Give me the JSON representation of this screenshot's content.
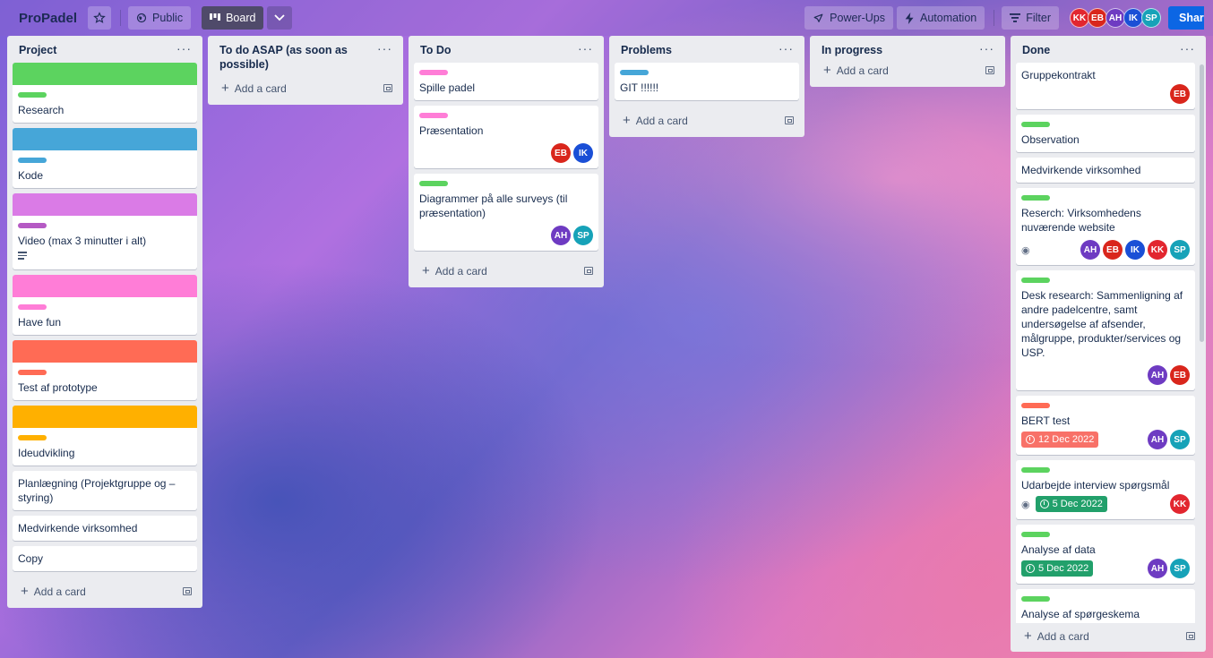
{
  "header": {
    "board_title": "ProPadel",
    "visibility_label": "Public",
    "view_label": "Board",
    "powerups_label": "Power-Ups",
    "automation_label": "Automation",
    "filter_label": "Filter",
    "share_label": "Share",
    "members": [
      {
        "initials": "KK",
        "color": "#e2262f"
      },
      {
        "initials": "EB",
        "color": "#d9261c"
      },
      {
        "initials": "AH",
        "color": "#6e3bc2"
      },
      {
        "initials": "IK",
        "color": "#1a4fd6"
      },
      {
        "initials": "SP",
        "color": "#16a2b8"
      }
    ]
  },
  "colors": {
    "green": "#61bd4f",
    "blue": "#3fa0d8",
    "purple": "#d77ee8",
    "purple_label": "#a35ec7",
    "pink": "#ff7ad4",
    "red": "#ff6f59",
    "orange": "#ffab00"
  },
  "lists": [
    {
      "title": "Project",
      "add_card": "Add a card",
      "cards": [
        {
          "title": "Research",
          "cover": "#5cd35f",
          "label": "#5cd35f"
        },
        {
          "title": "Kode",
          "cover": "#46a6d8",
          "label": "#46a6d8"
        },
        {
          "title": "Video (max 3 minutter i alt)",
          "cover": "#da7be6",
          "label": "#b55ac4",
          "has_description": true
        },
        {
          "title": "Have fun",
          "cover": "#ff7dd7",
          "label": "#ff7dd7"
        },
        {
          "title": "Test af prototype",
          "cover": "#ff6b55",
          "label": "#ff6b55"
        },
        {
          "title": "Ideudvikling",
          "cover": "#ffb000",
          "label": "#ffb000"
        },
        {
          "title": "Planlægning (Projektgruppe og – styring)"
        },
        {
          "title": "Medvirkende virksomhed"
        },
        {
          "title": "Copy"
        }
      ]
    },
    {
      "title": "To do ASAP (as soon as possible)",
      "add_card": "Add a card",
      "cards": []
    },
    {
      "title": "To Do",
      "add_card": "Add a card",
      "cards": [
        {
          "title": "Spille padel",
          "label": "#ff7dd7"
        },
        {
          "title": "Præsentation",
          "label": "#ff7dd7",
          "members": [
            "EB",
            "IK"
          ]
        },
        {
          "title": "Diagrammer på alle surveys (til præsentation)",
          "label": "#5cd35f",
          "members": [
            "AH",
            "SP"
          ]
        }
      ]
    },
    {
      "title": "Problems",
      "add_card": "Add a card",
      "cards": [
        {
          "title": "GIT !!!!!!",
          "label": "#46a6d8"
        }
      ]
    },
    {
      "title": "In progress",
      "add_card": "Add a card",
      "cards": []
    },
    {
      "title": "Done",
      "add_card": "Add a card",
      "cards": [
        {
          "title": "Gruppekontrakt",
          "members": [
            "EB"
          ]
        },
        {
          "title": "Observation",
          "label": "#5cd35f"
        },
        {
          "title": "Medvirkende virksomhed"
        },
        {
          "title": "Reserch: Virksomhedens nuværende website",
          "label": "#5cd35f",
          "watching": true,
          "members": [
            "AH",
            "EB",
            "IK",
            "KK",
            "SP"
          ]
        },
        {
          "title": "Desk research: Sammenligning af andre padelcentre, samt undersøgelse af afsender, målgruppe, produkter/services og USP.",
          "label": "#5cd35f",
          "members": [
            "AH",
            "EB"
          ]
        },
        {
          "title": "BERT test",
          "label": "#ff6b55",
          "due": "12 Dec 2022",
          "due_state": "overdue",
          "members": [
            "AH",
            "SP"
          ]
        },
        {
          "title": "Udarbejde interview spørgsmål",
          "label": "#5cd35f",
          "watching": true,
          "due": "5 Dec 2022",
          "due_state": "complete",
          "members": [
            "KK"
          ]
        },
        {
          "title": "Analyse af data",
          "label": "#5cd35f",
          "due": "5 Dec 2022",
          "due_state": "complete",
          "members": [
            "AH",
            "SP"
          ]
        },
        {
          "title": "Analyse af spørgeskema",
          "label": "#5cd35f"
        }
      ]
    }
  ]
}
